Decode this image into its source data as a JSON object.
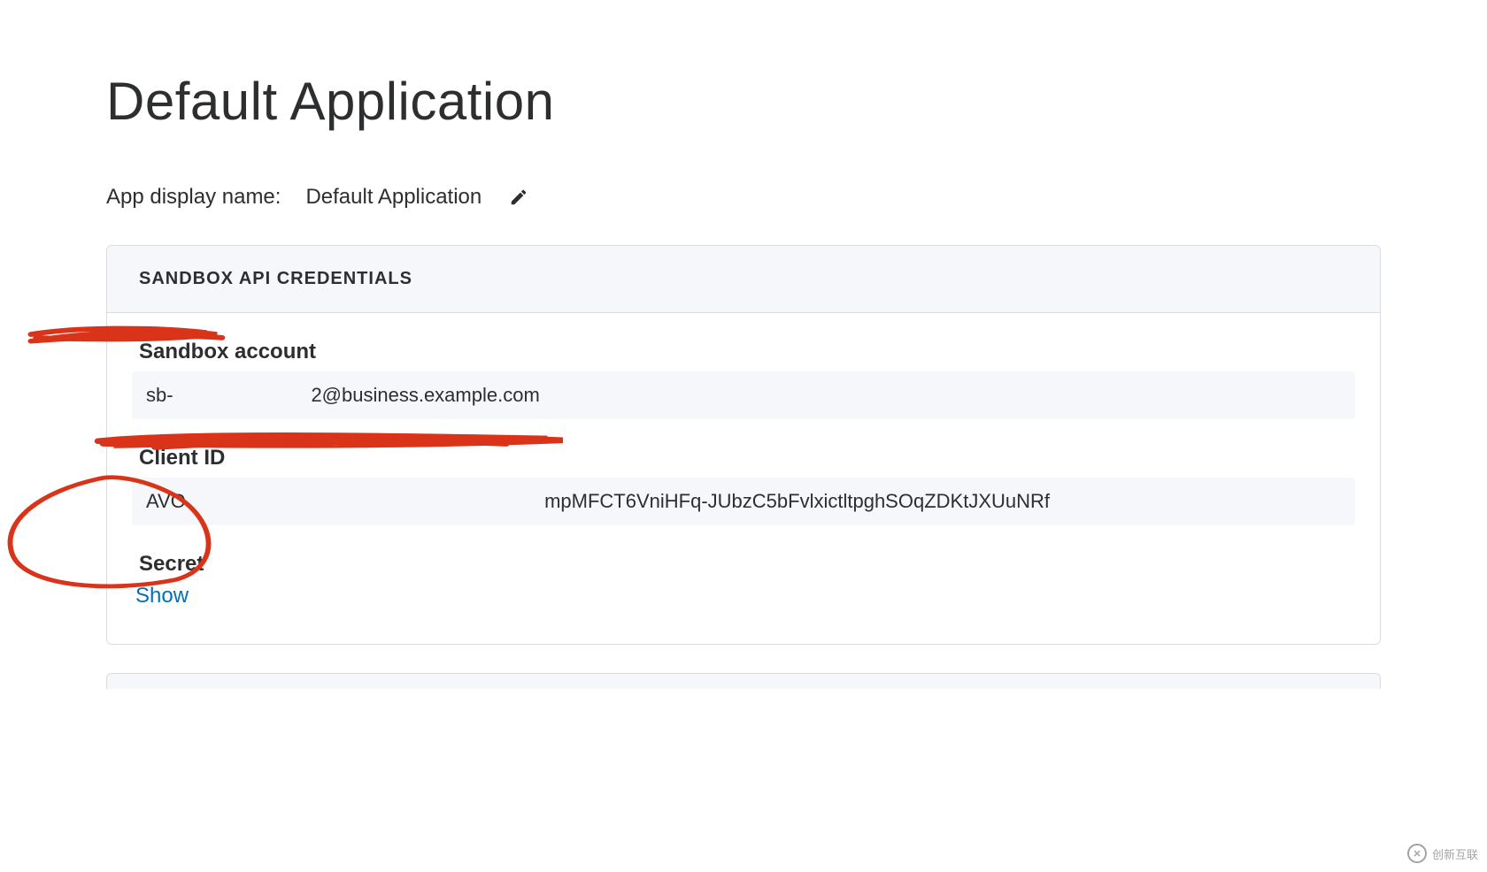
{
  "page": {
    "title": "Default Application"
  },
  "displayName": {
    "label": "App display name:",
    "value": "Default Application"
  },
  "credentials": {
    "header": "SANDBOX API CREDENTIALS",
    "sandboxAccount": {
      "label": "Sandbox account",
      "value_visible_suffix": "2@business.example.com",
      "value_redacted_prefix": "sb-"
    },
    "clientId": {
      "label": "Client ID",
      "value_visible_prefix": "AVO",
      "value_visible_suffix": "mpMFCT6VniHFq-JUbzC5bFvlxictltpghSOqZDKtJXUuNRf"
    },
    "secret": {
      "label": "Secret",
      "showLink": "Show"
    }
  },
  "watermark": {
    "text": "创新互联"
  }
}
